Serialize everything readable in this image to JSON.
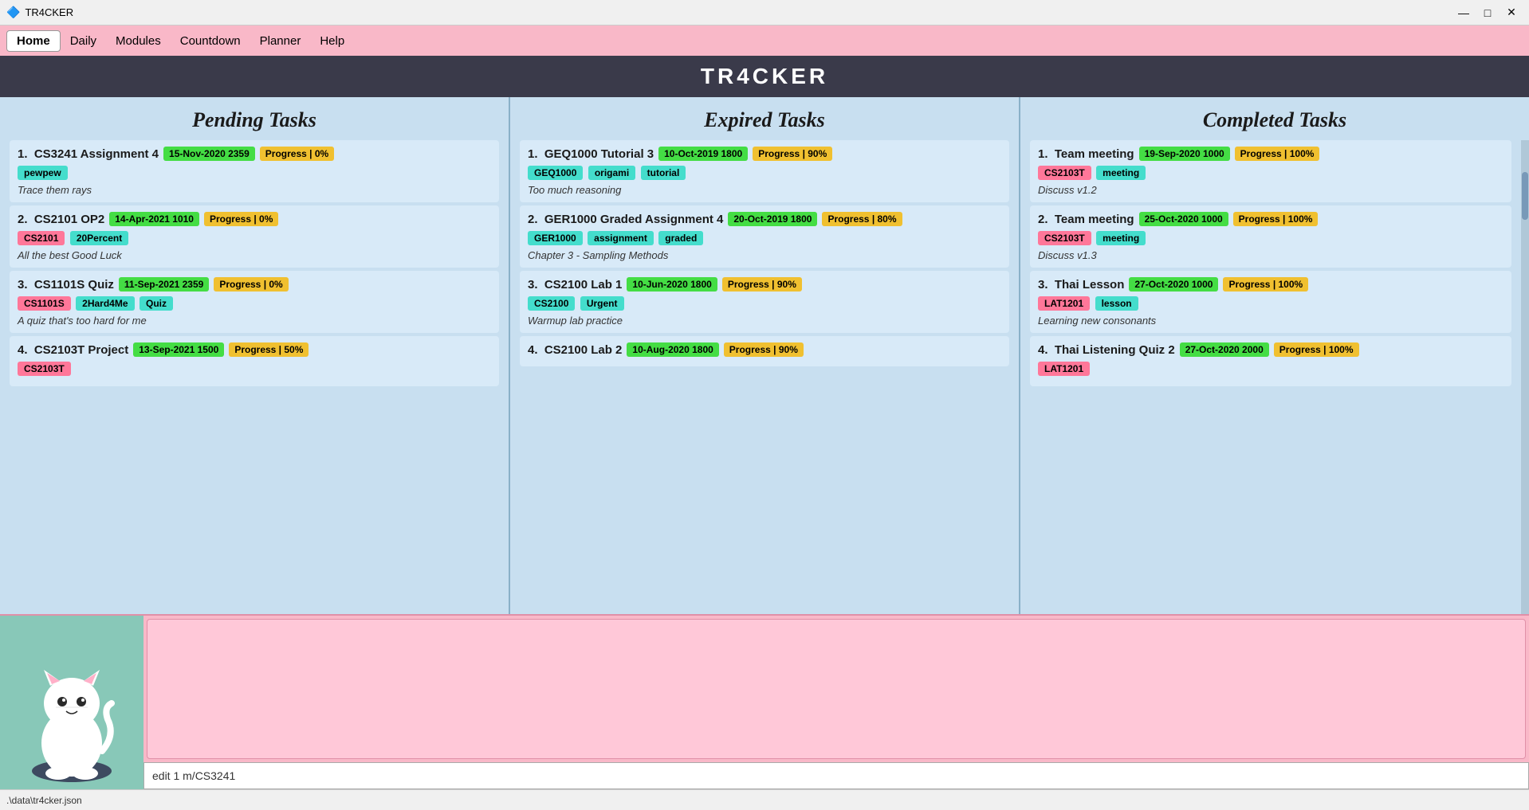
{
  "titlebar": {
    "app_name": "TR4CKER",
    "minimize": "—",
    "maximize": "□",
    "close": "✕"
  },
  "menu": {
    "items": [
      {
        "label": "Home",
        "active": true
      },
      {
        "label": "Daily",
        "active": false
      },
      {
        "label": "Modules",
        "active": false
      },
      {
        "label": "Countdown",
        "active": false
      },
      {
        "label": "Planner",
        "active": false
      },
      {
        "label": "Help",
        "active": false
      }
    ]
  },
  "app_title": "TR4CKER",
  "columns": {
    "pending": {
      "title": "Pending Tasks",
      "tasks": [
        {
          "number": "1.",
          "title": "CS3241 Assignment 4",
          "date": "15-Nov-2020 2359",
          "progress": "Progress | 0%",
          "tags": [
            {
              "label": "pewpew",
              "color": "cyan"
            }
          ],
          "desc": "Trace them rays"
        },
        {
          "number": "2.",
          "title": "CS2101 OP2",
          "date": "14-Apr-2021 1010",
          "progress": "Progress | 0%",
          "tags": [
            {
              "label": "CS2101",
              "color": "pink"
            },
            {
              "label": "20Percent",
              "color": "cyan"
            }
          ],
          "desc": "All the best Good Luck"
        },
        {
          "number": "3.",
          "title": "CS1101S Quiz",
          "date": "11-Sep-2021 2359",
          "progress": "Progress | 0%",
          "tags": [
            {
              "label": "CS1101S",
              "color": "pink"
            },
            {
              "label": "2Hard4Me",
              "color": "cyan"
            },
            {
              "label": "Quiz",
              "color": "cyan"
            }
          ],
          "desc": "A quiz that's too hard for me"
        },
        {
          "number": "4.",
          "title": "CS2103T Project",
          "date": "13-Sep-2021 1500",
          "progress": "Progress | 50%",
          "tags": [
            {
              "label": "CS2103T",
              "color": "pink"
            }
          ],
          "desc": ""
        }
      ]
    },
    "expired": {
      "title": "Expired Tasks",
      "tasks": [
        {
          "number": "1.",
          "title": "GEQ1000 Tutorial 3",
          "date": "10-Oct-2019 1800",
          "progress": "Progress | 90%",
          "tags": [
            {
              "label": "GEQ1000",
              "color": "cyan"
            },
            {
              "label": "origami",
              "color": "cyan"
            },
            {
              "label": "tutorial",
              "color": "cyan"
            }
          ],
          "desc": "Too much reasoning"
        },
        {
          "number": "2.",
          "title": "GER1000 Graded Assignment 4",
          "date": "20-Oct-2019 1800",
          "progress": "Progress | 80%",
          "tags": [
            {
              "label": "GER1000",
              "color": "cyan"
            },
            {
              "label": "assignment",
              "color": "cyan"
            },
            {
              "label": "graded",
              "color": "cyan"
            }
          ],
          "desc": "Chapter 3 - Sampling Methods"
        },
        {
          "number": "3.",
          "title": "CS2100 Lab 1",
          "date": "10-Jun-2020 1800",
          "progress": "Progress | 90%",
          "tags": [
            {
              "label": "CS2100",
              "color": "cyan"
            },
            {
              "label": "Urgent",
              "color": "cyan"
            }
          ],
          "desc": "Warmup lab practice"
        },
        {
          "number": "4.",
          "title": "CS2100 Lab 2",
          "date": "10-Aug-2020 1800",
          "progress": "Progress | 90%",
          "tags": [],
          "desc": ""
        }
      ]
    },
    "completed": {
      "title": "Completed Tasks",
      "tasks": [
        {
          "number": "1.",
          "title": "Team meeting",
          "date": "19-Sep-2020 1000",
          "progress": "Progress | 100%",
          "tags": [
            {
              "label": "CS2103T",
              "color": "pink"
            },
            {
              "label": "meeting",
              "color": "cyan"
            }
          ],
          "desc": "Discuss v1.2"
        },
        {
          "number": "2.",
          "title": "Team meeting",
          "date": "25-Oct-2020 1000",
          "progress": "Progress | 100%",
          "tags": [
            {
              "label": "CS2103T",
              "color": "pink"
            },
            {
              "label": "meeting",
              "color": "cyan"
            }
          ],
          "desc": "Discuss v1.3"
        },
        {
          "number": "3.",
          "title": "Thai Lesson",
          "date": "27-Oct-2020 1000",
          "progress": "Progress | 100%",
          "tags": [
            {
              "label": "LAT1201",
              "color": "pink"
            },
            {
              "label": "lesson",
              "color": "cyan"
            }
          ],
          "desc": "Learning new consonants"
        },
        {
          "number": "4.",
          "title": "Thai Listening Quiz 2",
          "date": "27-Oct-2020 2000",
          "progress": "Progress | 100%",
          "tags": [
            {
              "label": "LAT1201",
              "color": "pink"
            }
          ],
          "desc": ""
        }
      ]
    }
  },
  "command_input": "edit 1 m/CS3241",
  "status_bar": ".\\data\\tr4cker.json"
}
